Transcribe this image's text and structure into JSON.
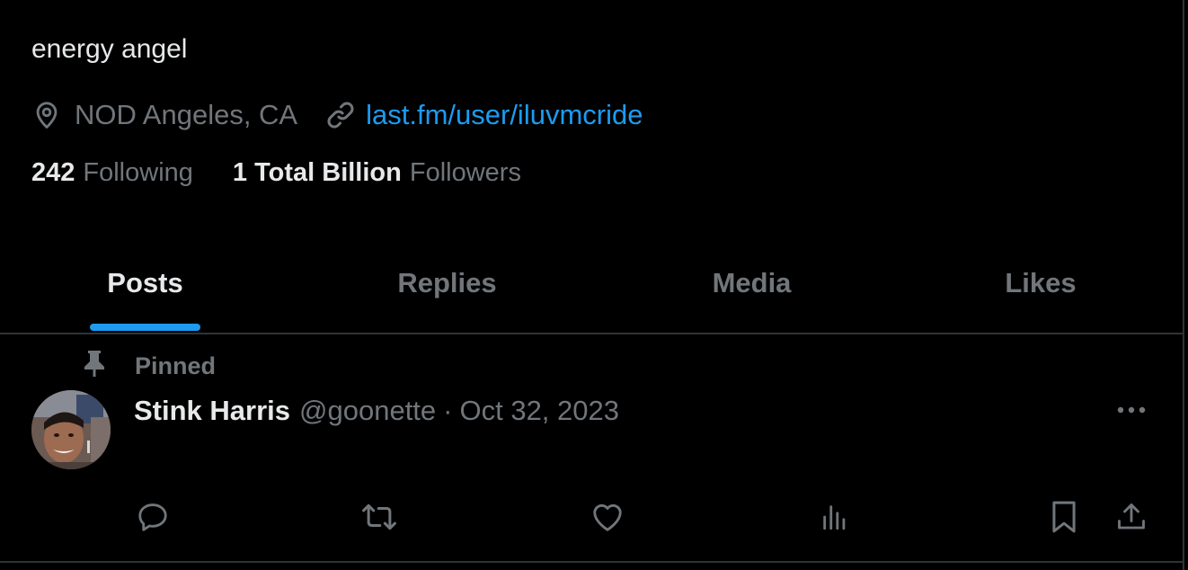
{
  "profile": {
    "bio": "energy angel",
    "location": "NOD Angeles, CA",
    "location_icon": "location-pin-icon",
    "website": "last.fm/user/iluvmcride",
    "website_icon": "link-icon",
    "following_count": "242",
    "following_label": "Following",
    "followers_count": "1 Total Billion",
    "followers_label": "Followers"
  },
  "tabs": [
    {
      "label": "Posts",
      "active": true
    },
    {
      "label": "Replies",
      "active": false
    },
    {
      "label": "Media",
      "active": false
    },
    {
      "label": "Likes",
      "active": false
    }
  ],
  "post": {
    "pinned_label": "Pinned",
    "pinned_icon": "pin-icon",
    "display_name": "Stink Harris",
    "handle": "@goonette",
    "separator": "·",
    "date": "Oct 32, 2023",
    "more_icon": "more-icon",
    "actions": [
      "reply-icon",
      "repost-icon",
      "like-icon",
      "views-icon",
      "bookmark-icon",
      "share-icon"
    ]
  },
  "colors": {
    "background": "#000000",
    "primary_text": "#e7e9ea",
    "secondary_text": "#71767b",
    "accent": "#1d9bf0",
    "divider": "#2f3336"
  }
}
